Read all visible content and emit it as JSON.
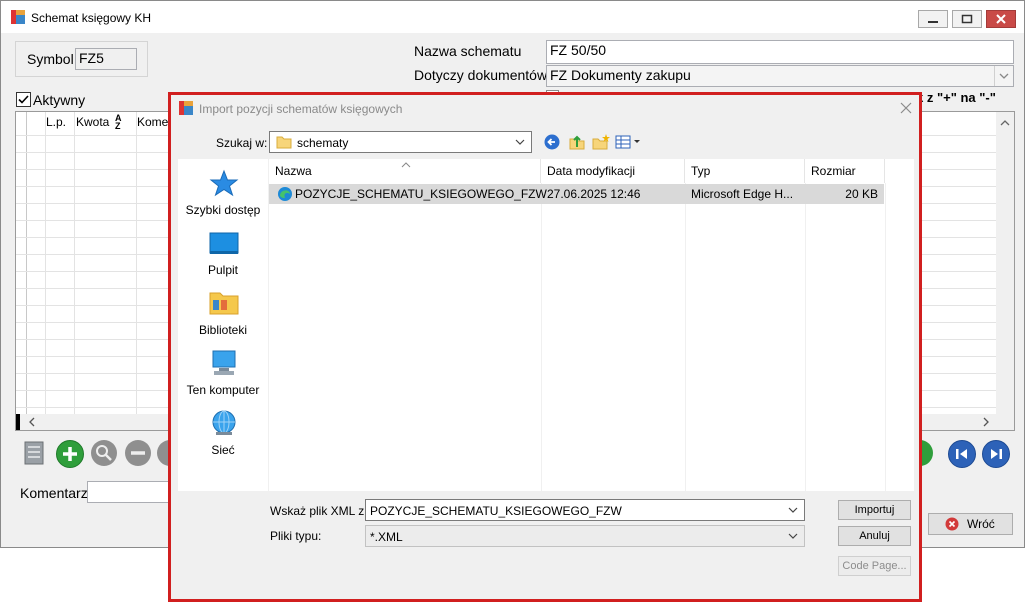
{
  "main_window": {
    "title": "Schemat księgowy KH",
    "symbol_label": "Symbol",
    "symbol_value": "FZ5",
    "schema_name_label": "Nazwa schematu",
    "schema_name_value": "FZ 50/50",
    "documents_label": "Dotyczy dokumentów",
    "documents_value": "FZ Dokumenty zakupu",
    "partial_checkbox_text": "k z \"+\" na \"-\"",
    "active_label": "Aktywny",
    "grid_headers": [
      "L.p.",
      "Kwota",
      "Kome"
    ],
    "comment_label": "Komentarz",
    "back_button_label": "Wróć"
  },
  "dialog": {
    "title": "Import pozycji schematów księgowych",
    "look_in_label": "Szukaj w:",
    "look_in_value": "schematy",
    "places": [
      "Szybki dostęp",
      "Pulpit",
      "Biblioteki",
      "Ten komputer",
      "Sieć"
    ],
    "columns": [
      "Nazwa",
      "Data modyfikacji",
      "Typ",
      "Rozmiar"
    ],
    "files": [
      {
        "name": "POZYCJE_SCHEMATU_KSIEGOWEGO_FZW",
        "modified": "27.06.2025 12:46",
        "type": "Microsoft Edge H...",
        "size": "20 KB"
      }
    ],
    "xml_file_label": "Wskaż plik XML z",
    "xml_file_value": "POZYCJE_SCHEMATU_KSIEGOWEGO_FZW",
    "file_type_label": "Pliki typu:",
    "file_type_value": "*.XML",
    "import_button": "Importuj",
    "cancel_button": "Anuluj",
    "codepage_button": "Code Page..."
  },
  "colors": {
    "highlight_border": "#d11f1f",
    "close_button": "#c94a47",
    "green_button": "#2f9e3b",
    "nav_blue": "#2d62b8"
  }
}
